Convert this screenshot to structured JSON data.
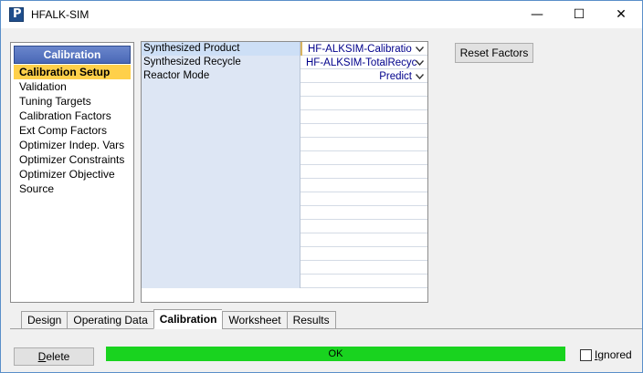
{
  "window": {
    "title": "HFALK-SIM",
    "icon": "app-icon",
    "controls": {
      "minimize": "—",
      "maximize": "☐",
      "close": "✕"
    }
  },
  "nav": {
    "header": "Calibration",
    "items": [
      {
        "label": "Calibration Setup",
        "selected": true
      },
      {
        "label": "Validation"
      },
      {
        "label": "Tuning Targets"
      },
      {
        "label": "Calibration Factors"
      },
      {
        "label": "Ext Comp Factors"
      },
      {
        "label": "Optimizer Indep. Vars"
      },
      {
        "label": "Optimizer Constraints"
      },
      {
        "label": "Optimizer Objective"
      },
      {
        "label": "Source"
      }
    ]
  },
  "grid": {
    "rows": [
      {
        "label": "Synthesized Product",
        "value": "HF-ALKSIM-Calibratio"
      },
      {
        "label": "Synthesized Recycle",
        "value": "HF-ALKSIM-TotalRecyc"
      },
      {
        "label": "Reactor Mode",
        "value": "Predict"
      }
    ]
  },
  "buttons": {
    "reset_factors": "Reset Factors",
    "delete_prefix": "D",
    "delete_rest": "elete"
  },
  "tabs": [
    {
      "label": "Design"
    },
    {
      "label": "Operating Data"
    },
    {
      "label": "Calibration",
      "active": true
    },
    {
      "label": "Worksheet"
    },
    {
      "label": "Results"
    }
  ],
  "status": {
    "text": "OK",
    "color": "#19d31f"
  },
  "ignored": {
    "prefix": "I",
    "rest": "gnored",
    "checked": false
  }
}
